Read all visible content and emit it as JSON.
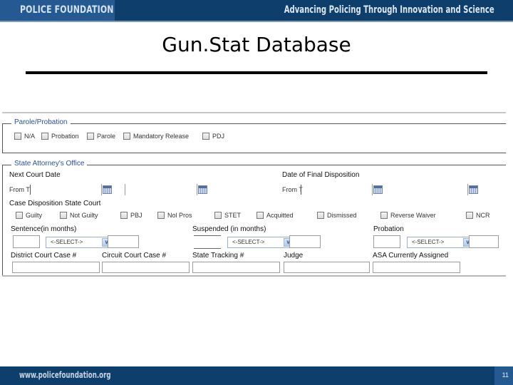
{
  "banner": {
    "brand": "POLICE FOUNDATION",
    "tagline": "Advancing Policing Through  Innovation and Science"
  },
  "slide": {
    "title": "Gun.Stat Database",
    "page_number": "11"
  },
  "footer": {
    "url": "www.policefoundation.org"
  },
  "form": {
    "parole_probation": {
      "legend": "Parole/Probation",
      "options": [
        {
          "label": "N/A",
          "checked": false
        },
        {
          "label": "Probation",
          "checked": false
        },
        {
          "label": "Parole",
          "checked": false
        },
        {
          "label": "Mandatory Release",
          "checked": false
        },
        {
          "label": "PDJ",
          "checked": false
        }
      ]
    },
    "state_attorney": {
      "legend": "State Attorney's Office",
      "next_court_date": {
        "label": "Next Court Date",
        "from_label": "From T",
        "from_value": "",
        "to_value": ""
      },
      "final_disposition": {
        "label": "Date of Final Disposition",
        "from_label": "From T",
        "from_value": "",
        "to_value": ""
      },
      "case_disposition": {
        "label": "Case Disposition State Court",
        "options": [
          {
            "label": "Guilty",
            "checked": false
          },
          {
            "label": "Not Guilty",
            "checked": false
          },
          {
            "label": "PBJ",
            "checked": false
          },
          {
            "label": "Nol Pros",
            "checked": false
          },
          {
            "label": "STET",
            "checked": false
          },
          {
            "label": "Acquitted",
            "checked": false
          },
          {
            "label": "Dismissed",
            "checked": false
          },
          {
            "label": "Reverse Waiver",
            "checked": false
          },
          {
            "label": "NCR",
            "checked": false
          }
        ]
      },
      "sentence": {
        "label": "Sentence(in months)",
        "select_value": "<-SELECT->",
        "value_1": "",
        "value_2": ""
      },
      "suspended": {
        "label": "Suspended (in months)",
        "select_value": "<-SELECT->",
        "value_1": "",
        "value_2": ""
      },
      "probation": {
        "label": "Probation",
        "select_value": "<-SELECT->",
        "value_1": "",
        "value_2": ""
      },
      "district_court_case": {
        "label": "District Court Case #",
        "value": ""
      },
      "circuit_court_case": {
        "label": "Circuit Court Case #",
        "value": ""
      },
      "state_tracking": {
        "label": "State Tracking #",
        "value": ""
      },
      "judge": {
        "label": "Judge",
        "value": ""
      },
      "asa_assigned": {
        "label": "ASA Currently Assigned",
        "value": ""
      }
    }
  },
  "icons": {
    "calendar": "calendar-icon",
    "dropdown": "chevron-down-icon"
  },
  "colors": {
    "banner_dark": "#0e3e6b",
    "banner_light": "#245a91",
    "legend_text": "#2c4f9e"
  }
}
